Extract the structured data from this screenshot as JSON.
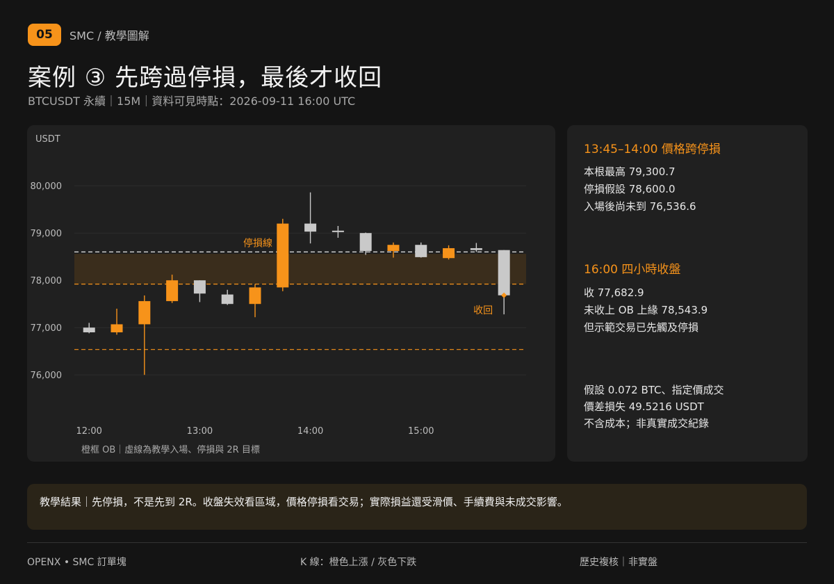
{
  "header": {
    "badge": "05",
    "breadcrumb": "SMC  /  教學圖解",
    "title": "案例 ③  先跨過停損，最後才收回",
    "subtitle": "BTCUSDT 永續｜15M｜資料可見時點：2026-09-11 16:00 UTC"
  },
  "chart_data": {
    "type": "candlestick",
    "ylabel": "USDT",
    "ylim": [
      75400,
      80400
    ],
    "yticks": [
      76000,
      77000,
      78000,
      79000,
      80000
    ],
    "ytick_labels": [
      "76,000",
      "77,000",
      "78,000",
      "79,000",
      "80,000"
    ],
    "xlim": [
      "11:52",
      "15:57"
    ],
    "xticks": [
      "12:00",
      "13:00",
      "14:00",
      "15:00"
    ],
    "candles": [
      {
        "time": "12:00",
        "open": 77000,
        "high": 77100,
        "low": 76880,
        "close": 76900
      },
      {
        "time": "12:15",
        "open": 76900,
        "high": 77400,
        "low": 76850,
        "close": 77070
      },
      {
        "time": "12:30",
        "open": 77070,
        "high": 77680,
        "low": 76000,
        "close": 77560
      },
      {
        "time": "12:45",
        "open": 77560,
        "high": 78120,
        "low": 77520,
        "close": 78000
      },
      {
        "time": "13:00",
        "open": 78000,
        "high": 78000,
        "low": 77540,
        "close": 77720
      },
      {
        "time": "13:15",
        "open": 77700,
        "high": 77800,
        "low": 77480,
        "close": 77500
      },
      {
        "time": "13:30",
        "open": 77500,
        "high": 77920,
        "low": 77220,
        "close": 77850
      },
      {
        "time": "13:45",
        "open": 77850,
        "high": 79300.7,
        "low": 77770,
        "close": 79200
      },
      {
        "time": "14:00",
        "open": 79200,
        "high": 79860,
        "low": 78780,
        "close": 79030
      },
      {
        "time": "14:15",
        "open": 79050,
        "high": 79150,
        "low": 78900,
        "close": 79020
      },
      {
        "time": "14:30",
        "open": 79000,
        "high": 79010,
        "low": 78540,
        "close": 78620
      },
      {
        "time": "14:45",
        "open": 78620,
        "high": 78800,
        "low": 78480,
        "close": 78750
      },
      {
        "time": "15:00",
        "open": 78750,
        "high": 78800,
        "low": 78480,
        "close": 78490
      },
      {
        "time": "15:15",
        "open": 78470,
        "high": 78740,
        "low": 78440,
        "close": 78680
      },
      {
        "time": "15:30",
        "open": 78680,
        "high": 78790,
        "low": 78600,
        "close": 78640
      },
      {
        "time": "15:45",
        "open": 78640,
        "high": 78640,
        "low": 77280,
        "close": 77682.9
      }
    ],
    "ob_zone": [
      77920,
      78560
    ],
    "lines": [
      {
        "label": "停損線",
        "value": 78600,
        "color": "#e8e8e8"
      },
      {
        "label": "",
        "value": 77920,
        "color": "#f7931a"
      },
      {
        "label": "",
        "value": 76536.6,
        "color": "#f7931a"
      }
    ],
    "reclaim_marker": {
      "time": "15:45",
      "value": 77682.9,
      "label": "收回"
    },
    "note": "橙框 OB｜虛線為教學入場、停損與 2R 目標",
    "colors": {
      "up": "#f7931a",
      "down": "#c9c9c9",
      "grid": "#2c2c2c",
      "zone": "#3a2d1c"
    }
  },
  "info": {
    "sec1": {
      "heading": "13:45–14:00 價格跨停損",
      "lines": [
        "本根最高 79,300.7",
        "停損假設 78,600.0",
        "入場後尚未到 76,536.6"
      ]
    },
    "sec2": {
      "heading": "16:00 四小時收盤",
      "lines": [
        "收 77,682.9",
        "未收上 OB 上緣 78,543.9",
        "但示範交易已先觸及停損"
      ]
    },
    "sec3": {
      "lines": [
        "假設 0.072 BTC、指定價成交",
        "價差損失 49.5216 USDT",
        "不含成本；非真實成交紀錄"
      ]
    }
  },
  "result": "教學結果｜先停損，不是先到 2R。收盤失效看區域，價格停損看交易；實際損益還受滑價、手續費與未成交影響。",
  "footer": {
    "left": "OPENX  •  SMC 訂單塊",
    "center": "K 線：橙色上漲 / 灰色下跌",
    "right": "歷史複核｜非實盤"
  }
}
